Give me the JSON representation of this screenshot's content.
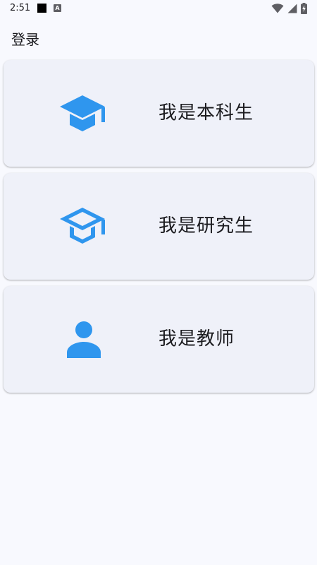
{
  "status_bar": {
    "time": "2:51",
    "notification_icons": [
      "black-square-icon",
      "a-letter-icon"
    ],
    "system_icons": [
      "wifi-icon",
      "signal-icon",
      "battery-charging-icon"
    ]
  },
  "header": {
    "title": "登录"
  },
  "roles": [
    {
      "label": "我是本科生",
      "icon": "graduation-cap-filled-icon"
    },
    {
      "label": "我是研究生",
      "icon": "graduation-cap-outline-icon"
    },
    {
      "label": "我是教师",
      "icon": "person-icon"
    }
  ],
  "colors": {
    "accent": "#2f96ee",
    "background": "#f8f9fe",
    "card": "#eff1f9",
    "text": "#1b1b1f"
  }
}
